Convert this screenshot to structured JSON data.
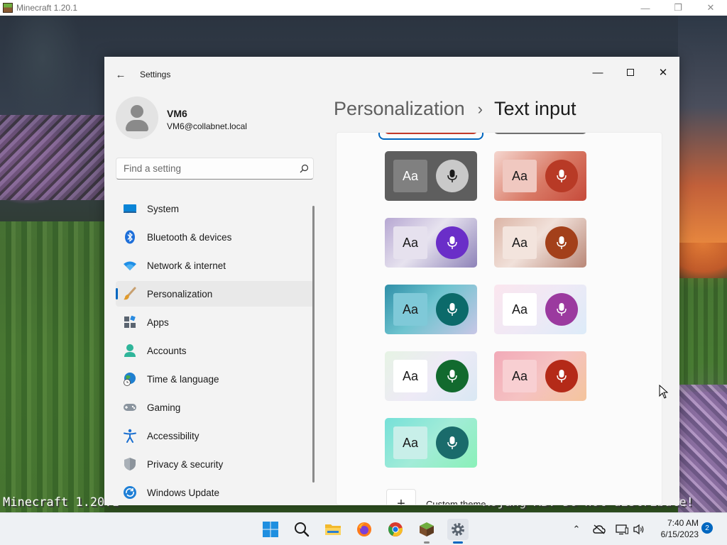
{
  "minecraft": {
    "window_title": "Minecraft 1.20.1",
    "overlay_left": "Minecraft 1.20.1",
    "overlay_right": "Mojang AB. Do not distribute!"
  },
  "settings": {
    "app_title": "Settings",
    "profile": {
      "name": "VM6",
      "email": "VM6@collabnet.local"
    },
    "search": {
      "placeholder": "Find a setting"
    },
    "nav": [
      {
        "label": "System",
        "icon": "system-icon"
      },
      {
        "label": "Bluetooth & devices",
        "icon": "bluetooth-icon"
      },
      {
        "label": "Network & internet",
        "icon": "wifi-icon"
      },
      {
        "label": "Personalization",
        "icon": "paintbrush-icon",
        "active": true
      },
      {
        "label": "Apps",
        "icon": "apps-icon"
      },
      {
        "label": "Accounts",
        "icon": "accounts-icon"
      },
      {
        "label": "Time & language",
        "icon": "globe-clock-icon"
      },
      {
        "label": "Gaming",
        "icon": "gamepad-icon"
      },
      {
        "label": "Accessibility",
        "icon": "accessibility-icon"
      },
      {
        "label": "Privacy & security",
        "icon": "shield-icon"
      },
      {
        "label": "Windows Update",
        "icon": "update-icon"
      }
    ],
    "breadcrumb": {
      "parent": "Personalization",
      "separator": "›",
      "current": "Text input"
    },
    "themes": [
      {
        "aa": "Aa",
        "aa_bg": "#808080",
        "aa_fg": "#ffffff",
        "mic_bg": "#c9c9c9",
        "mic_fg": "#1a1a1a",
        "bg": "#5e5e5e"
      },
      {
        "aa": "Aa",
        "aa_bg": "#f0c8c0",
        "aa_fg": "#1a1a1a",
        "mic_bg": "#b83a26",
        "mic_fg": "#ffffff",
        "bg": "linear-gradient(135deg,#f5d6cf,#d97a66 55%,#c64a3a)"
      },
      {
        "aa": "Aa",
        "aa_bg": "#e6e1ee",
        "aa_fg": "#1a1a1a",
        "mic_bg": "#6a2ec8",
        "mic_fg": "#ffffff",
        "bg": "linear-gradient(135deg,#b6a7d2,#e7e3ef 45%,#8d82b8)"
      },
      {
        "aa": "Aa",
        "aa_bg": "#f3e4dd",
        "aa_fg": "#1a1a1a",
        "mic_bg": "#a3401a",
        "mic_fg": "#ffffff",
        "bg": "linear-gradient(135deg,#dcb5a6,#f1e1da 45%,#b98777)"
      },
      {
        "aa": "Aa",
        "aa_bg": "#7fc9d8",
        "aa_fg": "#1a1a1a",
        "mic_bg": "#0b6a6a",
        "mic_fg": "#ffffff",
        "bg": "linear-gradient(135deg,#2f8fa8,#6ec4cf 45%,#c8c6e6)"
      },
      {
        "aa": "Aa",
        "aa_bg": "#ffffff",
        "aa_fg": "#1a1a1a",
        "mic_bg": "#9b3a9f",
        "mic_fg": "#ffffff",
        "bg": "linear-gradient(135deg,#fbe6ee,#efe9f6 50%,#dcebf8)"
      },
      {
        "aa": "Aa",
        "aa_bg": "#ffffff",
        "aa_fg": "#1a1a1a",
        "mic_bg": "#126a2e",
        "mic_fg": "#ffffff",
        "bg": "linear-gradient(135deg,#e6f3e4,#eeeaf6 50%,#d9e8f3)"
      },
      {
        "aa": "Aa",
        "aa_bg": "#f8cfd2",
        "aa_fg": "#1a1a1a",
        "mic_bg": "#b42a18",
        "mic_fg": "#ffffff",
        "bg": "linear-gradient(135deg,#f2aab8,#f5c2c2 50%,#f4c49c)"
      },
      {
        "aa": "Aa",
        "aa_bg": "#c8efe9",
        "aa_fg": "#1a1a1a",
        "mic_bg": "#1a6b6b",
        "mic_fg": "#ffffff",
        "bg": "linear-gradient(135deg,#76e0d8,#a2ecd8 50%,#8af0b8)"
      }
    ],
    "custom_theme_label": "Custom theme"
  },
  "taskbar": {
    "apps": [
      {
        "name": "start",
        "icon": "windows-logo-icon"
      },
      {
        "name": "search",
        "icon": "search-icon"
      },
      {
        "name": "file-explorer",
        "icon": "folder-icon"
      },
      {
        "name": "firefox",
        "icon": "firefox-icon"
      },
      {
        "name": "chrome",
        "icon": "chrome-icon"
      },
      {
        "name": "minecraft",
        "icon": "minecraft-icon",
        "running": true
      },
      {
        "name": "settings",
        "icon": "gear-icon",
        "active": true
      }
    ],
    "time": "7:40 AM",
    "date": "6/15/2023",
    "notification_count": "2"
  },
  "colors": {
    "accent": "#0067c0"
  }
}
